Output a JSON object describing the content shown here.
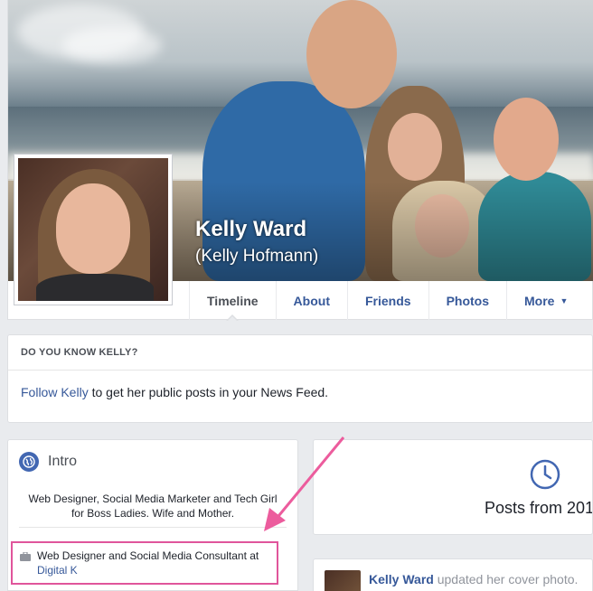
{
  "profile": {
    "name": "Kelly Ward",
    "alternate_name": "(Kelly Hofmann)"
  },
  "tabs": [
    {
      "label": "Timeline",
      "active": true
    },
    {
      "label": "About"
    },
    {
      "label": "Friends"
    },
    {
      "label": "Photos"
    },
    {
      "label": "More",
      "has_caret": true
    }
  ],
  "know_box": {
    "title": "DO YOU KNOW KELLY?",
    "follow_link": "Follow Kelly",
    "follow_text": " to get her public posts in your News Feed."
  },
  "intro": {
    "title": "Intro",
    "bio": "Web Designer, Social Media Marketer and Tech Girl for Boss Ladies. Wife and Mother.",
    "work_text": "Web Designer and Social Media Consultant at",
    "work_link": "Digital K"
  },
  "posts": {
    "label": "Posts from 201"
  },
  "update": {
    "author": "Kelly Ward",
    "action": " updated her cover photo."
  },
  "colors": {
    "link": "#365899",
    "highlight": "#e0559b",
    "page_bg": "#e9ebee"
  }
}
